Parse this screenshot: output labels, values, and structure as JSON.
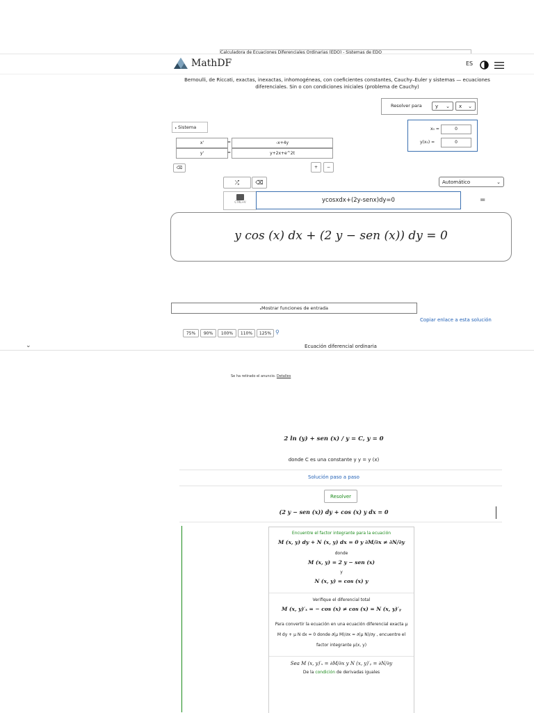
{
  "page_title_fragment": "Calculadora de Ecuaciones Diferenciales Ordinarias (EDO) - Sistemas de EDO",
  "header": {
    "logo_text": "MathDF",
    "lang": "ES"
  },
  "description": "Bernoulli, de Riccati, exactas, inexactas, inhomogéneas, con coeficientes constantes, Cauchy–Euler y sistemas — ecuaciones diferenciales. Sin o con condiciones iniciales (problema de Cauchy)",
  "solve_for": {
    "label": "Resolver para",
    "var1": "y",
    "var2": "x"
  },
  "system": {
    "label": "Sistema",
    "rows": [
      {
        "lhs": "x'",
        "eq": "=",
        "rhs": "-x+4y"
      },
      {
        "lhs": "y'",
        "eq": "=",
        "rhs": "y+2x+e^2t"
      }
    ],
    "plus": "+",
    "minus": "−"
  },
  "initial": {
    "x0_label": "x₀ =",
    "x0_value": "0",
    "yx0_label": "y(x₀) =",
    "yx0_value": "0"
  },
  "mode_select": "Automático",
  "camera_caption": "CTRL+V",
  "equation_input": "ycosxdx+(2y-senx)dy=0",
  "equals_button": "=",
  "preview_math": "y cos (x) dx + (2 y − sen (x)) dy = 0",
  "show_functions_button": "Mostrar funciones de entrada",
  "copy_link": "Copiar enlace a esta solución",
  "zoom_levels": [
    "75%",
    "90%",
    "100%",
    "110%",
    "125%"
  ],
  "equation_type": "Ecuación diferencial ordinaria",
  "ad_removed": "Se ha retirado el anuncio.",
  "ad_details": "Detalles",
  "answer": {
    "solution_math": "2 ln (y) + sen (x) / y = C,  y = 0",
    "where_text": "donde C es una constante y y = y (x)",
    "step_link": "Solución paso a paso",
    "solve_button": "Resolver",
    "ode_line": "(2 y − sen (x)) dy + cos (x) y dx = 0"
  },
  "steps": {
    "s1_title": "Encuentre el factor integrante para la ecuación",
    "s1_eq": "M (x, y) dy + N (x, y) dx = 0 y ∂M/∂x ≠ ∂N/∂y",
    "s1_donde": "donde",
    "s1_M": "M (x, y) = 2 y − sen (x)",
    "s1_y": "y",
    "s1_N": "N (x, y) = cos (x) y",
    "s2_title": "Verifique el diferencial total",
    "s2_eq": "M (x, y)′ₓ = − cos (x) ≠ cos (x) = N (x, y)′ᵧ",
    "s2_text": "Para convertir la ecuación en una ecuación diferencial exacta μ M dy + μ N dx = 0 donde ∂(μ M)/∂x = ∂(μ N)/∂y , encuentre el factor integrante μ(x, y)",
    "s3_eq": "Sea M (x, y)′ₓ = ∂M/∂x y N (x, y)′ᵧ = ∂N/∂y",
    "s3_text_pre": "De la",
    "s3_link": "condición",
    "s3_text_post": "de derivadas iguales"
  },
  "colors": {
    "accent_link": "#1f5fb5",
    "step_green": "#1a8a1a",
    "not_equal_red": "#d01a1a",
    "border_blue": "#3a6fb0"
  }
}
